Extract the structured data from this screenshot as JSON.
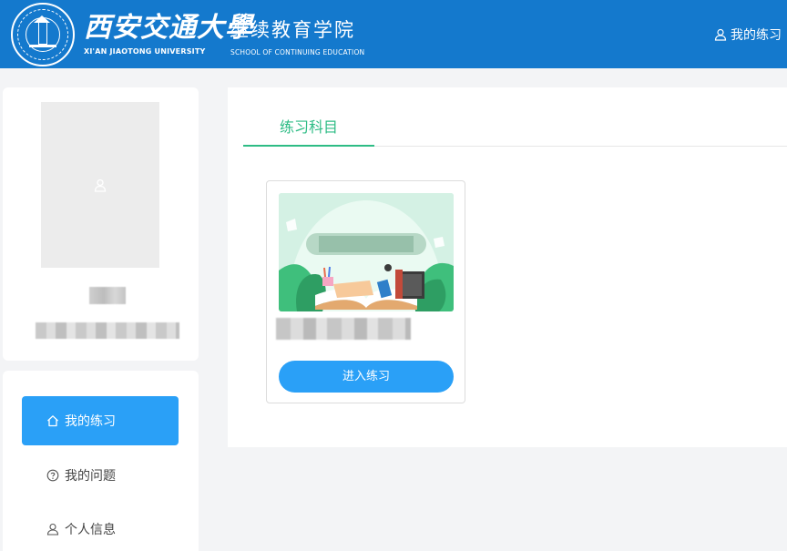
{
  "header": {
    "brand_cn": "西安交通大學",
    "brand_en": "XI'AN JIAOTONG UNIVERSITY",
    "school_cn": "继续教育学院",
    "school_en": "SCHOOL OF CONTINUING EDUCATION",
    "user_link": "我的练习",
    "background_color": "#1479cd"
  },
  "sidebar": {
    "items": [
      {
        "label": "我的练习",
        "icon": "home-icon",
        "active": true
      },
      {
        "label": "我的问题",
        "icon": "question-circle-icon",
        "active": false
      },
      {
        "label": "个人信息",
        "icon": "user-icon",
        "active": false
      }
    ],
    "active_color": "#2aa0f7"
  },
  "main": {
    "tabs": [
      {
        "label": "练习科目",
        "active": true
      }
    ],
    "tab_color": "#2ebc85",
    "subject": {
      "button_label": "进入练习"
    }
  }
}
